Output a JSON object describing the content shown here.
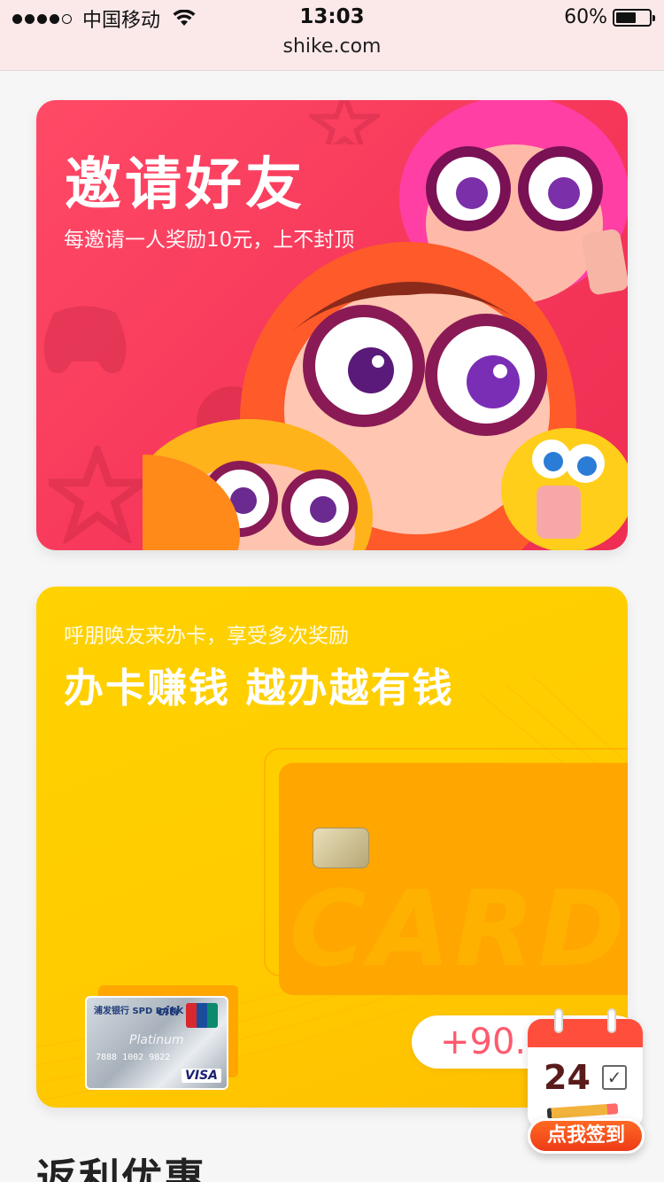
{
  "status_bar": {
    "carrier": "中国移动",
    "time": "13:03",
    "battery": "60%",
    "battery_level": 0.6,
    "url": "shike.com"
  },
  "invite_card": {
    "title": "邀请好友",
    "subtitle": "每邀请一人奖励10元，上不封顶",
    "accent": "#f6375a"
  },
  "card_offer": {
    "small_text": "呼朋唤友来办卡，享受多次奖励",
    "headline": "办卡赚钱 越办越有钱",
    "card_watermark": "CARD",
    "reward": "+90.0",
    "accent": "#ffcb00",
    "sample_card": {
      "bank": "浦发银行 SPD BANK",
      "brand": "citi",
      "tier": "Platinum",
      "number": "7888 1002 9822",
      "network": "VISA"
    }
  },
  "signin_widget": {
    "day": "24",
    "button": "点我签到"
  },
  "section_heading": "返利优惠"
}
